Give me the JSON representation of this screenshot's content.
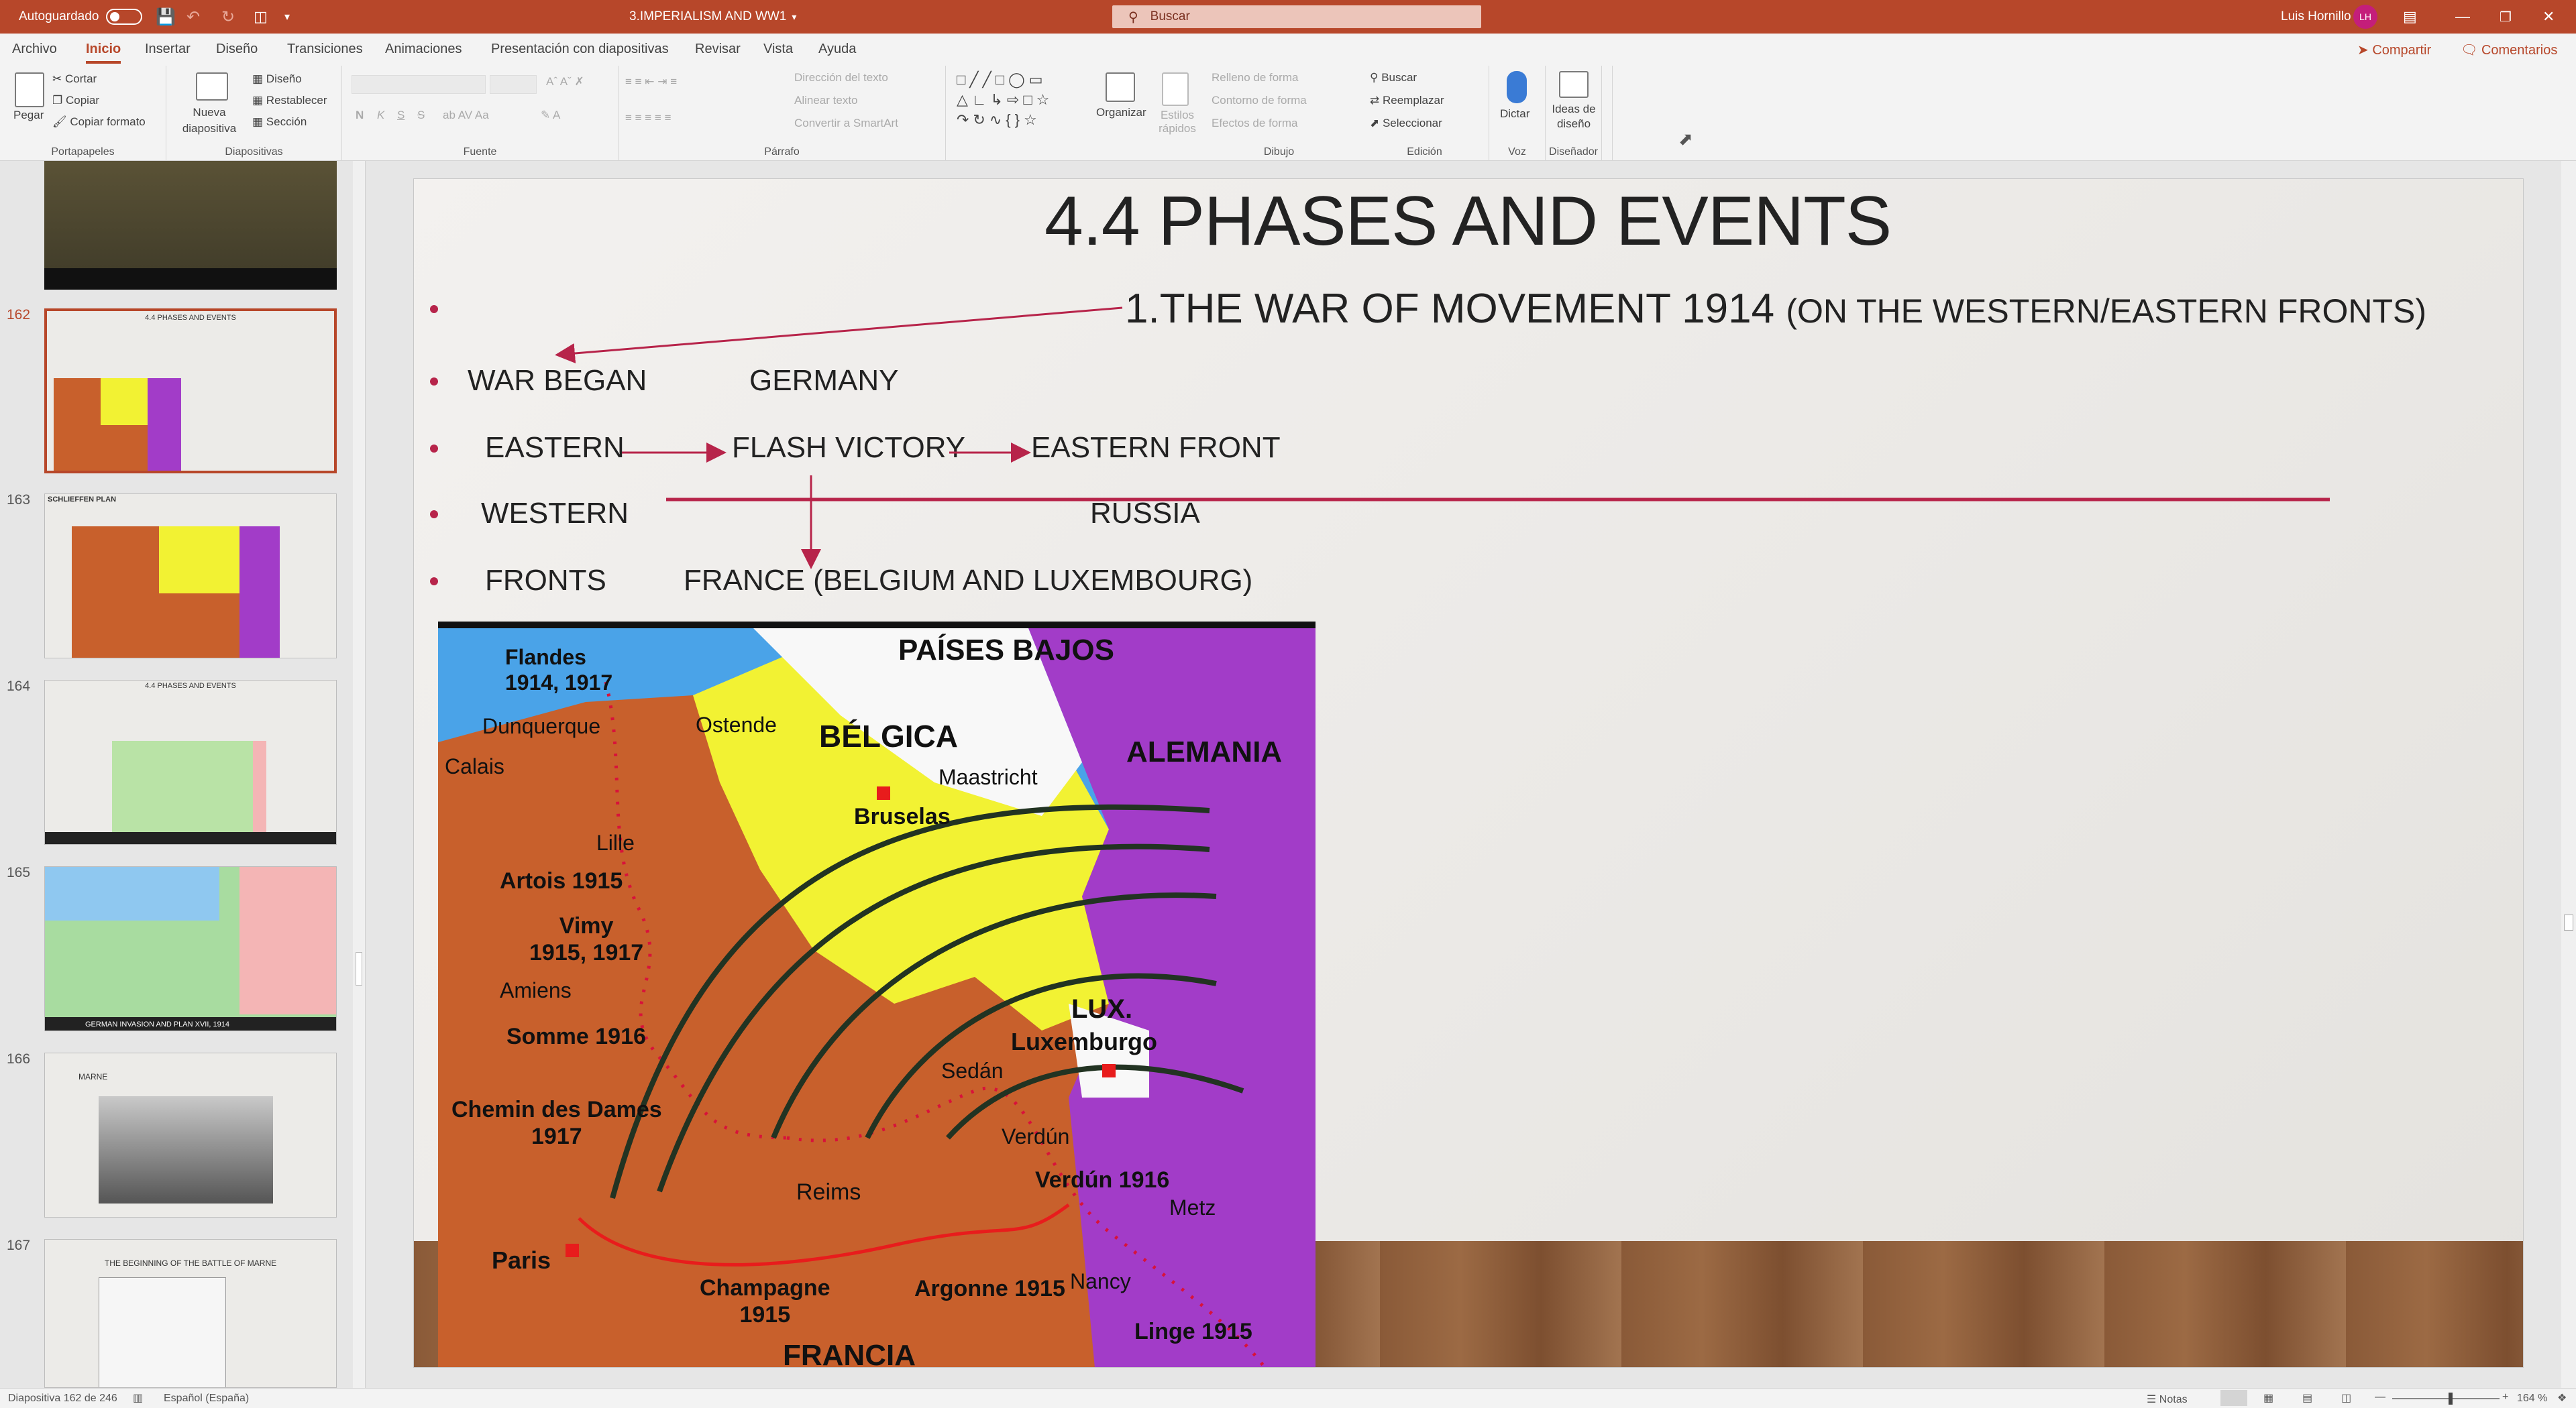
{
  "titlebar": {
    "autosave_label": "Autoguardado",
    "doc_title": "3.IMPERIALISM AND WW1",
    "search_placeholder": "Buscar",
    "user_name": "Luis Hornillo",
    "user_initials": "LH"
  },
  "tabs": [
    "Archivo",
    "Inicio",
    "Insertar",
    "Diseño",
    "Transiciones",
    "Animaciones",
    "Presentación con diapositivas",
    "Revisar",
    "Vista",
    "Ayuda"
  ],
  "active_tab": "Inicio",
  "share_label": "Compartir",
  "comments_label": "Comentarios",
  "ribbon": {
    "portapapeles": {
      "paste": "Pegar",
      "cut": "Cortar",
      "copy": "Copiar",
      "format": "Copiar formato",
      "label": "Portapapeles"
    },
    "diapositivas": {
      "new": "Nueva diapositiva",
      "layout": "Diseño",
      "reset": "Restablecer",
      "section": "Sección",
      "label": "Diapositivas"
    },
    "fuente": {
      "label": "Fuente",
      "bold": "N",
      "italic": "K",
      "underline": "S",
      "strike": "S"
    },
    "parrafo": {
      "label": "Párrafo",
      "dir": "Dirección del texto",
      "align": "Alinear texto",
      "smartart": "Convertir a SmartArt"
    },
    "dibujo": {
      "arrange": "Organizar",
      "styles": "Estilos rápidos",
      "fill": "Relleno de forma",
      "outline": "Contorno de forma",
      "effects": "Efectos de forma",
      "label": "Dibujo"
    },
    "edicion": {
      "find": "Buscar",
      "replace": "Reemplazar",
      "select": "Seleccionar",
      "label": "Edición"
    },
    "voz": {
      "dictate": "Dictar",
      "label": "Voz"
    },
    "disenador": {
      "ideas": "Ideas de diseño",
      "label": "Diseñador"
    }
  },
  "slides_panel": [
    {
      "num": "162",
      "title": "4.4 PHASES AND EVENTS",
      "selected": true
    },
    {
      "num": "163",
      "title": "SCHLIEFFEN PLAN",
      "selected": false
    },
    {
      "num": "164",
      "title": "4.4 PHASES AND EVENTS",
      "selected": false
    },
    {
      "num": "165",
      "title": "GERMAN INVASION AND PLAN XVII, 1914",
      "selected": false
    },
    {
      "num": "166",
      "title": "MARNE",
      "selected": false
    },
    {
      "num": "167",
      "title": "THE BEGINNING OF THE BATTLE OF MARNE",
      "selected": false
    }
  ],
  "slide": {
    "title": "4.4 PHASES AND EVENTS",
    "heading": "1.THE WAR OF MOVEMENT 1914",
    "heading_paren": "(ON THE WESTERN/EASTERN FRONTS)",
    "rows": [
      {
        "left": "WAR BEGAN",
        "mid": "GERMANY"
      },
      {
        "left": "EASTERN",
        "mid": "FLASH VICTORY",
        "right": "EASTERN FRONT"
      },
      {
        "left": "WESTERN",
        "right": "RUSSIA"
      },
      {
        "left": "FRONTS",
        "mid": "FRANCE (BELGIUM AND LUXEMBOURG)"
      }
    ]
  },
  "map_labels": {
    "paises_bajos": "PAÍSES BAJOS",
    "flandes": "Flandes\n1914, 1917",
    "dunquerque": "Dunquerque",
    "ostende": "Ostende",
    "belgica": "BÉLGICA",
    "alemania": "ALEMANIA",
    "calais": "Calais",
    "maastricht": "Maastricht",
    "bruselas": "Bruselas",
    "lille": "Lille",
    "artois": "Artois 1915",
    "vimy": "Vimy\n1915, 1917",
    "amiens": "Amiens",
    "somme": "Somme 1916",
    "lux": "LUX.",
    "luxemburgo": "Luxemburgo",
    "sedan": "Sedán",
    "chemin": "Chemin des Dames\n1917",
    "verdun": "Verdún",
    "verdun1916": "Verdún 1916",
    "reims": "Reims",
    "metz": "Metz",
    "paris": "Paris",
    "champagne": "Champagne\n1915",
    "argonne": "Argonne 1915",
    "nancy": "Nancy",
    "linge": "Linge 1915",
    "francia": "FRANCIA"
  },
  "status": {
    "slide_info": "Diapositiva 162 de 246",
    "language": "Español (España)",
    "notes": "Notas",
    "zoom": "164 %"
  },
  "colors": {
    "accent": "#b7472a",
    "bullet": "#b7244a",
    "belgium": "#f2f233",
    "germany": "#a23cc8",
    "france": "#c8602c"
  }
}
